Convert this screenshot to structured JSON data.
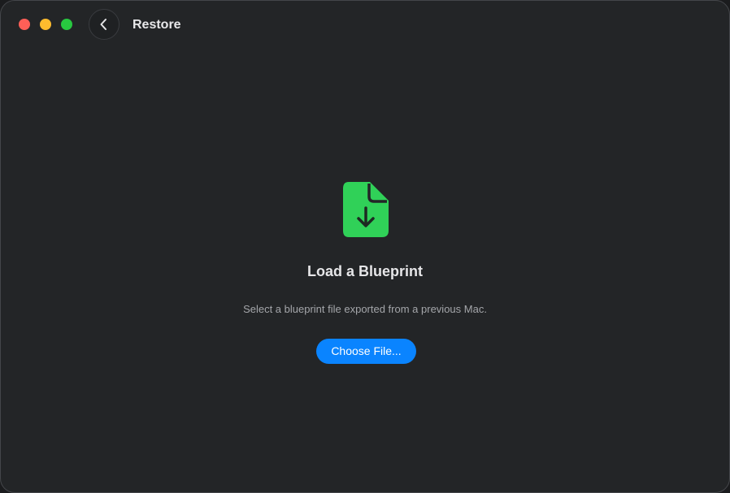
{
  "window": {
    "title": "Restore"
  },
  "traffic_lights": {
    "close_color": "#fe5f57",
    "minimize_color": "#febc2e",
    "zoom_color": "#28c840"
  },
  "back_button": {
    "icon": "chevron-left-icon"
  },
  "main": {
    "icon": "document-download-icon",
    "icon_color": "#30d158",
    "heading": "Load a Blueprint",
    "subtitle": "Select a blueprint file exported from a previous Mac.",
    "choose_button_label": "Choose File...",
    "accent_color": "#0a84ff"
  }
}
